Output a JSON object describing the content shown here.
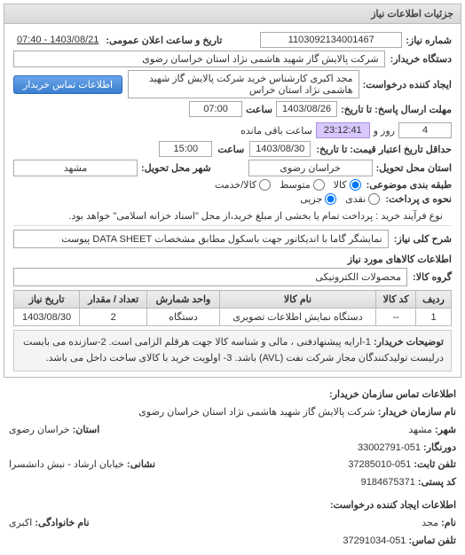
{
  "panel": {
    "title": "جزئیات اطلاعات نیاز"
  },
  "header": {
    "req_no_label": "شماره نیاز:",
    "req_no": "1103092134001467",
    "announce_label": "تاریخ و ساعت اعلان عمومی:",
    "announce_value": "1403/08/21 - 07:40",
    "buyer_label": "دستگاه خریدار:",
    "buyer_value": "شرکت پالایش گاز شهید هاشمی نژاد   استان خراسان رضوی",
    "creator_label": "ایجاد کننده درخواست:",
    "creator_value": "مجد اکبری کارشناس خرید شرکت پالایش گاز شهید هاشمی نژاد   استان خراس",
    "contact_btn": "اطلاعات تماس خریدار",
    "deadline_label": "مهلت ارسال پاسخ: تا تاریخ:",
    "deadline_date": "1403/08/26",
    "time_label": "ساعت",
    "deadline_time": "07:00",
    "days_remain": "4",
    "days_remain_label": "روز و",
    "countdown": "23:12:41",
    "remain_label": "ساعت باقی مانده",
    "min_deadline_label": "حداقل تاریخ اعتبار قیمت: تا تاریخ:",
    "min_deadline_date": "1403/08/30",
    "min_deadline_time": "15:00",
    "province_label": "استان محل تحویل:",
    "province_value": "خراسان رضوی",
    "city_label": "شهر محل تحویل:",
    "city_value": "مشهد",
    "subject_class_label": "طبقه بندی موضوعی:",
    "subject_options": {
      "goods": "کالا",
      "medium": "متوسط",
      "service": "کالا/خدمت"
    },
    "partial_label": "نحوه ی پرداخت:",
    "partial_options": {
      "cash": "نقدی",
      "partial": "جزیی"
    },
    "process_note": "نوع فرآیند خرید : پرداخت تمام یا بخشی از مبلغ خرید،از محل \"اسناد خزانه اسلامی\" خواهد بود."
  },
  "need": {
    "title_label": "شرح کلی نیاز:",
    "title_value": "نمایشگر گاما با اندیکاتور جهت باسکول مطابق مشخصات DATA SHEET پیوست"
  },
  "goods": {
    "section_title": "اطلاعات کالاهای مورد نیاز",
    "group_label": "گروه کالا:",
    "group_value": "محصولات الکترونیکی",
    "table": {
      "headers": {
        "row": "ردیف",
        "code": "کد کالا",
        "name": "نام کالا",
        "unit": "واحد شمارش",
        "qty": "تعداد / مقدار",
        "date": "تاریخ نیاز"
      },
      "rows": [
        {
          "row": "1",
          "code": "--",
          "name": "دستگاه نمایش اطلاعات تصویری",
          "unit": "دستگاه",
          "qty": "2",
          "date": "1403/08/30"
        }
      ]
    }
  },
  "buyer_desc": {
    "label": "توضیحات خریدار:",
    "text": "1-ارایه پیشنهادفنی ، مالی و شناسه کالا جهت هرقلم الزامی است. 2-سازنده می بایست درلیست تولیدکنندگان مجاز شرکت نفت (AVL) باشد. 3- اولویت خرید با کالای ساخت داخل می باشد."
  },
  "contact": {
    "section_title": "اطلاعات تماس سازمان خریدار:",
    "org_label": "نام سازمان خریدار:",
    "org_value": "شرکت پالایش گاز شهید هاشمی نژاد استان خراسان رضوی",
    "city_label": "شهر:",
    "city_value": "مشهد",
    "province_label": "استان:",
    "province_value": "خراسان رضوی",
    "fax_label": "دورنگار:",
    "fax_value": "051-33002791",
    "phone_label": "تلفن ثابت:",
    "phone_value": "051-37285010",
    "address_label": "نشانی:",
    "address_value": "خیابان ارشاد - نبش دانشسرا",
    "postal_label": "کد پستی:",
    "postal_value": "9184675371"
  },
  "requester": {
    "section_title": "اطلاعات ایجاد کننده درخواست:",
    "name_label": "نام:",
    "name_value": "﻿مجد",
    "family_label": "نام خانوادگی:",
    "family_value": "اکبری",
    "phone_label": "تلفن تماس:",
    "phone_value": "051-37291034"
  }
}
